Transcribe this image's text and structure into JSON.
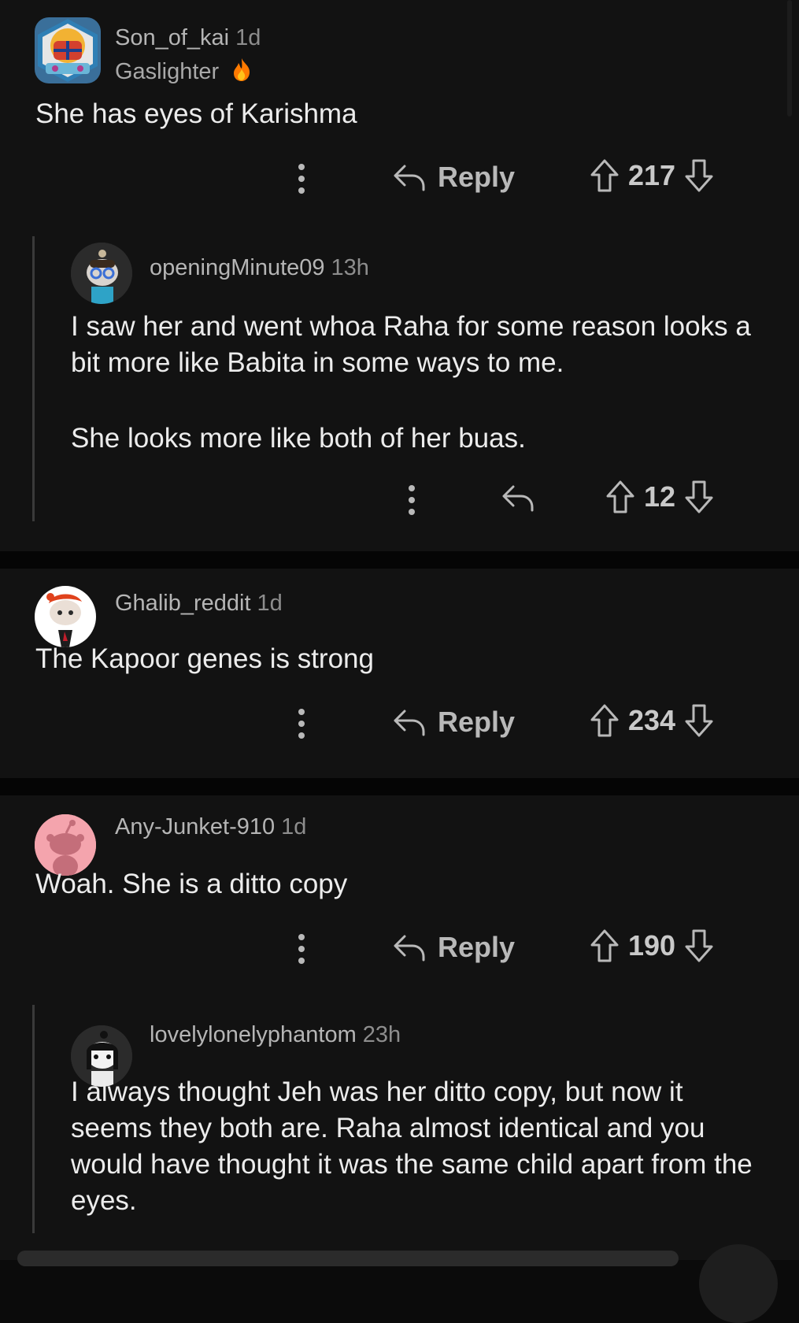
{
  "comments": [
    {
      "username": "Son_of_kai",
      "time": "1d",
      "flair": "Gaslighter",
      "flair_emoji": "🔥",
      "body": [
        "She has eyes of Karishma"
      ],
      "reply_label": "Reply",
      "score": "217",
      "avatar": "snoo-avatar-helmet"
    },
    {
      "username": "openingMinute09",
      "time": "13h",
      "body": [
        "I saw her and went whoa Raha for some reason looks a bit more like Babita in some ways to me.",
        "She looks more like both of her buas."
      ],
      "score": "12",
      "avatar": "snoo-avatar-glasses"
    },
    {
      "username": "Ghalib_reddit",
      "time": "1d",
      "body": [
        "The Kapoor genes is strong"
      ],
      "reply_label": "Reply",
      "score": "234",
      "avatar": "snoo-avatar-orange-hair"
    },
    {
      "username": "Any-Junket-910",
      "time": "1d",
      "body": [
        "Woah. She is a ditto copy"
      ],
      "reply_label": "Reply",
      "score": "190",
      "avatar": "snoo-avatar-pink"
    },
    {
      "username": "lovelylonelyphantom",
      "time": "23h",
      "body": [
        "I always thought Jeh was her ditto copy, but now it seems they both are. Raha almost identical and you would have thought it was the same child apart from the eyes."
      ],
      "avatar": "snoo-avatar-black-hair"
    }
  ],
  "colors": {
    "background": "#121212",
    "separator": "#050505",
    "text": "#ececec",
    "muted": "#b5b5b5",
    "avatar_pink": "#f4a4ad",
    "flair_fire": "#ff7a00"
  }
}
